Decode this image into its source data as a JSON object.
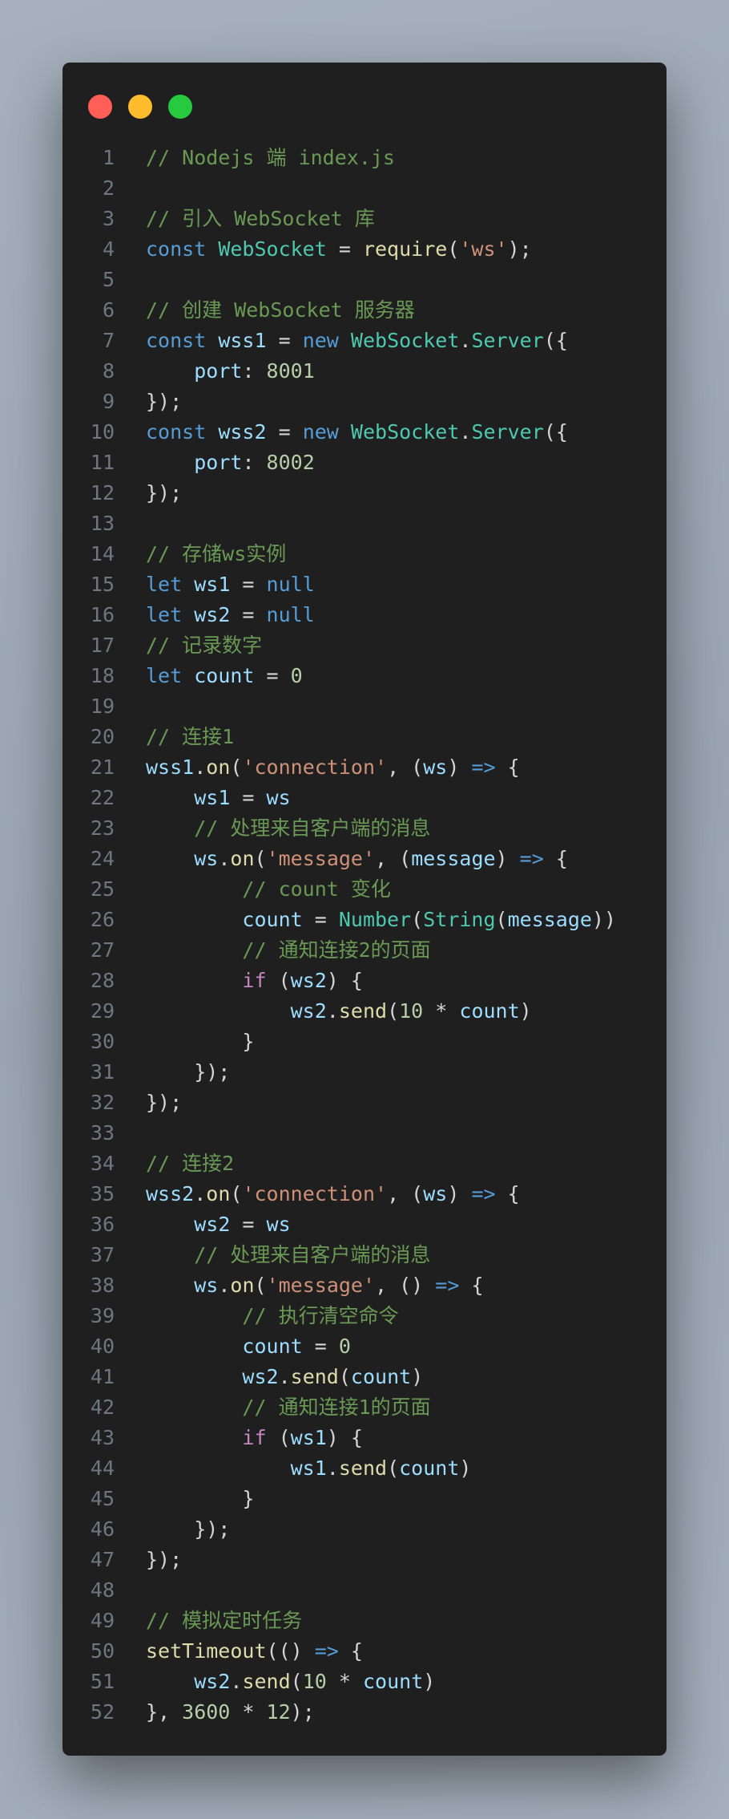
{
  "window_controls": {
    "close_color": "#ff5f56",
    "minimize_color": "#ffbd2e",
    "maximize_color": "#27c93f"
  },
  "lines": [
    [
      [
        "c",
        "// Nodejs 端 index.js"
      ]
    ],
    [],
    [
      [
        "c",
        "// 引入 WebSocket 库"
      ]
    ],
    [
      [
        "k",
        "const"
      ],
      [
        "p",
        " "
      ],
      [
        "t",
        "WebSocket"
      ],
      [
        "p",
        " = "
      ],
      [
        "f",
        "require"
      ],
      [
        "p",
        "("
      ],
      [
        "s",
        "'ws'"
      ],
      [
        "p",
        ");"
      ]
    ],
    [],
    [
      [
        "c",
        "// 创建 WebSocket 服务器"
      ]
    ],
    [
      [
        "k",
        "const"
      ],
      [
        "p",
        " "
      ],
      [
        "v",
        "wss1"
      ],
      [
        "p",
        " = "
      ],
      [
        "k",
        "new"
      ],
      [
        "p",
        " "
      ],
      [
        "t",
        "WebSocket"
      ],
      [
        "p",
        "."
      ],
      [
        "t",
        "Server"
      ],
      [
        "p",
        "({"
      ]
    ],
    [
      [
        "p",
        "    "
      ],
      [
        "v",
        "port"
      ],
      [
        "p",
        ": "
      ],
      [
        "n",
        "8001"
      ]
    ],
    [
      [
        "p",
        "});"
      ]
    ],
    [
      [
        "k",
        "const"
      ],
      [
        "p",
        " "
      ],
      [
        "v",
        "wss2"
      ],
      [
        "p",
        " = "
      ],
      [
        "k",
        "new"
      ],
      [
        "p",
        " "
      ],
      [
        "t",
        "WebSocket"
      ],
      [
        "p",
        "."
      ],
      [
        "t",
        "Server"
      ],
      [
        "p",
        "({"
      ]
    ],
    [
      [
        "p",
        "    "
      ],
      [
        "v",
        "port"
      ],
      [
        "p",
        ": "
      ],
      [
        "n",
        "8002"
      ]
    ],
    [
      [
        "p",
        "});"
      ]
    ],
    [],
    [
      [
        "c",
        "// 存储ws实例"
      ]
    ],
    [
      [
        "k",
        "let"
      ],
      [
        "p",
        " "
      ],
      [
        "v",
        "ws1"
      ],
      [
        "p",
        " = "
      ],
      [
        "k",
        "null"
      ]
    ],
    [
      [
        "k",
        "let"
      ],
      [
        "p",
        " "
      ],
      [
        "v",
        "ws2"
      ],
      [
        "p",
        " = "
      ],
      [
        "k",
        "null"
      ]
    ],
    [
      [
        "c",
        "// 记录数字"
      ]
    ],
    [
      [
        "k",
        "let"
      ],
      [
        "p",
        " "
      ],
      [
        "v",
        "count"
      ],
      [
        "p",
        " = "
      ],
      [
        "n",
        "0"
      ]
    ],
    [],
    [
      [
        "c",
        "// 连接1"
      ]
    ],
    [
      [
        "v",
        "wss1"
      ],
      [
        "p",
        "."
      ],
      [
        "f",
        "on"
      ],
      [
        "p",
        "("
      ],
      [
        "s",
        "'connection'"
      ],
      [
        "p",
        ", ("
      ],
      [
        "v",
        "ws"
      ],
      [
        "p",
        ") "
      ],
      [
        "k",
        "=>"
      ],
      [
        "p",
        " {"
      ]
    ],
    [
      [
        "p",
        "    "
      ],
      [
        "v",
        "ws1"
      ],
      [
        "p",
        " = "
      ],
      [
        "v",
        "ws"
      ]
    ],
    [
      [
        "p",
        "    "
      ],
      [
        "c",
        "// 处理来自客户端的消息"
      ]
    ],
    [
      [
        "p",
        "    "
      ],
      [
        "v",
        "ws"
      ],
      [
        "p",
        "."
      ],
      [
        "f",
        "on"
      ],
      [
        "p",
        "("
      ],
      [
        "s",
        "'message'"
      ],
      [
        "p",
        ", ("
      ],
      [
        "v",
        "message"
      ],
      [
        "p",
        ") "
      ],
      [
        "k",
        "=>"
      ],
      [
        "p",
        " {"
      ]
    ],
    [
      [
        "p",
        "        "
      ],
      [
        "c",
        "// count 变化"
      ]
    ],
    [
      [
        "p",
        "        "
      ],
      [
        "v",
        "count"
      ],
      [
        "p",
        " = "
      ],
      [
        "t",
        "Number"
      ],
      [
        "p",
        "("
      ],
      [
        "t",
        "String"
      ],
      [
        "p",
        "("
      ],
      [
        "v",
        "message"
      ],
      [
        "p",
        "))"
      ]
    ],
    [
      [
        "p",
        "        "
      ],
      [
        "c",
        "// 通知连接2的页面"
      ]
    ],
    [
      [
        "p",
        "        "
      ],
      [
        "x",
        "if"
      ],
      [
        "p",
        " ("
      ],
      [
        "v",
        "ws2"
      ],
      [
        "p",
        ") {"
      ]
    ],
    [
      [
        "p",
        "            "
      ],
      [
        "v",
        "ws2"
      ],
      [
        "p",
        "."
      ],
      [
        "f",
        "send"
      ],
      [
        "p",
        "("
      ],
      [
        "n",
        "10"
      ],
      [
        "p",
        " * "
      ],
      [
        "v",
        "count"
      ],
      [
        "p",
        ")"
      ]
    ],
    [
      [
        "p",
        "        }"
      ]
    ],
    [
      [
        "p",
        "    });"
      ]
    ],
    [
      [
        "p",
        "});"
      ]
    ],
    [],
    [
      [
        "c",
        "// 连接2"
      ]
    ],
    [
      [
        "v",
        "wss2"
      ],
      [
        "p",
        "."
      ],
      [
        "f",
        "on"
      ],
      [
        "p",
        "("
      ],
      [
        "s",
        "'connection'"
      ],
      [
        "p",
        ", ("
      ],
      [
        "v",
        "ws"
      ],
      [
        "p",
        ") "
      ],
      [
        "k",
        "=>"
      ],
      [
        "p",
        " {"
      ]
    ],
    [
      [
        "p",
        "    "
      ],
      [
        "v",
        "ws2"
      ],
      [
        "p",
        " = "
      ],
      [
        "v",
        "ws"
      ]
    ],
    [
      [
        "p",
        "    "
      ],
      [
        "c",
        "// 处理来自客户端的消息"
      ]
    ],
    [
      [
        "p",
        "    "
      ],
      [
        "v",
        "ws"
      ],
      [
        "p",
        "."
      ],
      [
        "f",
        "on"
      ],
      [
        "p",
        "("
      ],
      [
        "s",
        "'message'"
      ],
      [
        "p",
        ", () "
      ],
      [
        "k",
        "=>"
      ],
      [
        "p",
        " {"
      ]
    ],
    [
      [
        "p",
        "        "
      ],
      [
        "c",
        "// 执行清空命令"
      ]
    ],
    [
      [
        "p",
        "        "
      ],
      [
        "v",
        "count"
      ],
      [
        "p",
        " = "
      ],
      [
        "n",
        "0"
      ]
    ],
    [
      [
        "p",
        "        "
      ],
      [
        "v",
        "ws2"
      ],
      [
        "p",
        "."
      ],
      [
        "f",
        "send"
      ],
      [
        "p",
        "("
      ],
      [
        "v",
        "count"
      ],
      [
        "p",
        ")"
      ]
    ],
    [
      [
        "p",
        "        "
      ],
      [
        "c",
        "// 通知连接1的页面"
      ]
    ],
    [
      [
        "p",
        "        "
      ],
      [
        "x",
        "if"
      ],
      [
        "p",
        " ("
      ],
      [
        "v",
        "ws1"
      ],
      [
        "p",
        ") {"
      ]
    ],
    [
      [
        "p",
        "            "
      ],
      [
        "v",
        "ws1"
      ],
      [
        "p",
        "."
      ],
      [
        "f",
        "send"
      ],
      [
        "p",
        "("
      ],
      [
        "v",
        "count"
      ],
      [
        "p",
        ")"
      ]
    ],
    [
      [
        "p",
        "        }"
      ]
    ],
    [
      [
        "p",
        "    });"
      ]
    ],
    [
      [
        "p",
        "});"
      ]
    ],
    [],
    [
      [
        "c",
        "// 模拟定时任务"
      ]
    ],
    [
      [
        "f",
        "setTimeout"
      ],
      [
        "p",
        "(() "
      ],
      [
        "k",
        "=>"
      ],
      [
        "p",
        " {"
      ]
    ],
    [
      [
        "p",
        "    "
      ],
      [
        "v",
        "ws2"
      ],
      [
        "p",
        "."
      ],
      [
        "f",
        "send"
      ],
      [
        "p",
        "("
      ],
      [
        "n",
        "10"
      ],
      [
        "p",
        " * "
      ],
      [
        "v",
        "count"
      ],
      [
        "p",
        ")"
      ]
    ],
    [
      [
        "p",
        "}, "
      ],
      [
        "n",
        "3600"
      ],
      [
        "p",
        " * "
      ],
      [
        "n",
        "12"
      ],
      [
        "p",
        ");"
      ]
    ]
  ]
}
